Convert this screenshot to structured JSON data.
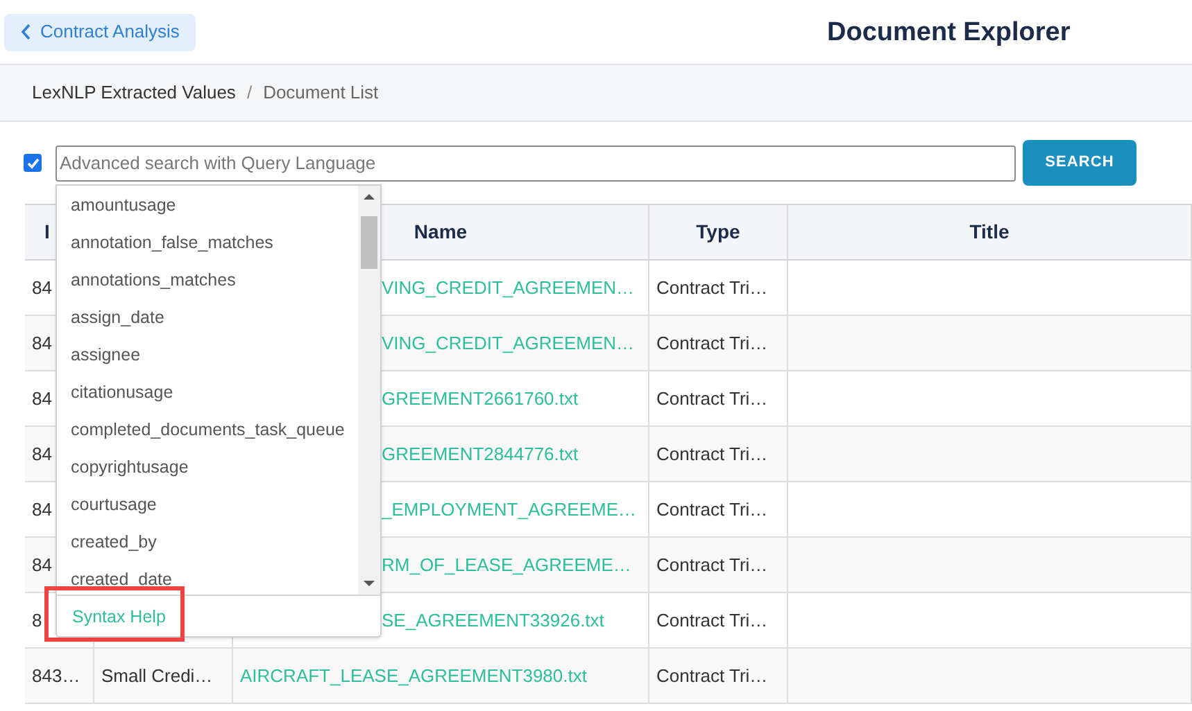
{
  "back_button": {
    "label": "Contract Analysis"
  },
  "page_title": "Document Explorer",
  "breadcrumb_separator": "/",
  "breadcrumb": [
    {
      "label": "LexNLP Extracted Values",
      "current": false
    },
    {
      "label": "Document List",
      "current": true
    }
  ],
  "search": {
    "checked": true,
    "placeholder": "Advanced search with Query Language",
    "button": "SEARCH"
  },
  "table": {
    "columns": [
      {
        "label": "I"
      },
      {},
      {
        "label": "Name"
      },
      {
        "label": "Type"
      },
      {
        "label": "Title"
      }
    ],
    "rows": [
      {
        "covered": true,
        "id": "84",
        "name": "VING_CREDIT_AGREEMEN…",
        "type": "Contract Tri…"
      },
      {
        "covered": true,
        "id": "84",
        "name": "VING_CREDIT_AGREEMEN…",
        "type": "Contract Tri…"
      },
      {
        "covered": true,
        "id": "84",
        "name": "GREEMENT2661760.txt",
        "type": "Contract Tri…"
      },
      {
        "covered": true,
        "id": "84",
        "name": "GREEMENT2844776.txt",
        "type": "Contract Tri…"
      },
      {
        "covered": true,
        "id": "84",
        "name": "_EMPLOYMENT_AGREEME…",
        "type": "Contract Tri…"
      },
      {
        "covered": true,
        "id": "84",
        "name": "RM_OF_LEASE_AGREEME…",
        "type": "Contract Tri…"
      },
      {
        "covered": true,
        "id": "8",
        "name": "SE_AGREEMENT33926.txt",
        "type": "Contract Tri…"
      },
      {
        "covered": false,
        "id": "843…",
        "col2": "Small Credi…",
        "name": "AIRCRAFT_LEASE_AGREEMENT3980.txt",
        "type": "Contract Tri…"
      }
    ]
  },
  "dropdown": {
    "items": [
      "amountusage",
      "annotation_false_matches",
      "annotations_matches",
      "assign_date",
      "assignee",
      "citationusage",
      "completed_documents_task_queue",
      "copyrightusage",
      "courtusage",
      "created_by",
      "created_date"
    ],
    "footer_link": {
      "label": "Syntax Help",
      "highlighted": true
    }
  }
}
